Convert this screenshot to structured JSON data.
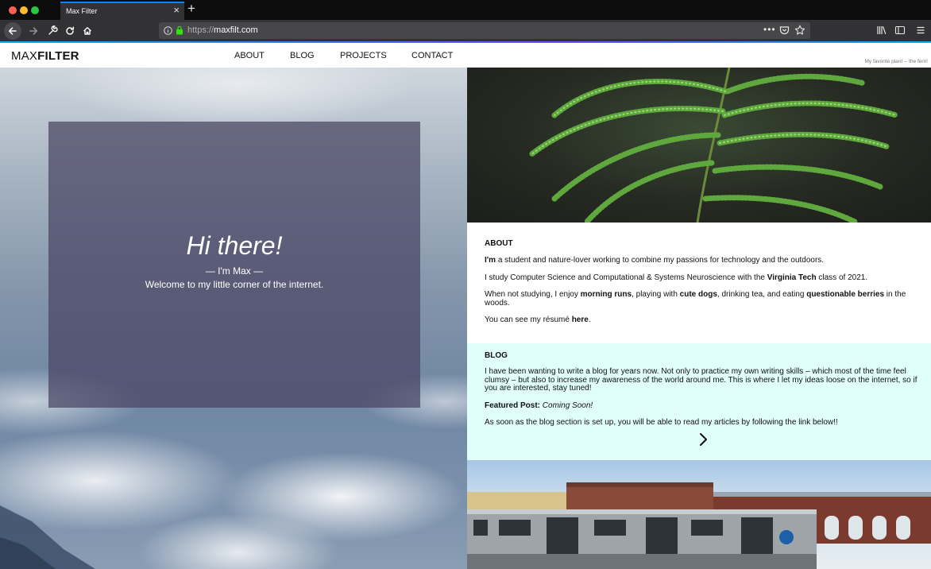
{
  "browser": {
    "tab_title": "Max Filter",
    "tab_close": "×",
    "new_tab": "+",
    "url_scheme": "https://",
    "url_host": "maxfilt.com",
    "url_more": "•••"
  },
  "nav": {
    "logo_light": "MAX",
    "logo_bold": "FILTER",
    "links": [
      "ABOUT",
      "BLOG",
      "PROJECTS",
      "CONTACT"
    ],
    "caption": "My favorite plant -- the fern!"
  },
  "hero": {
    "title": "Hi there!",
    "subtitle": "— I'm Max —",
    "welcome": "Welcome to my little corner of the internet."
  },
  "about": {
    "title": "ABOUT",
    "p1_bold": "I'm",
    "p1_rest": " a student and nature-lover working to combine my passions for technology and the outdoors.",
    "p2_start": "I study Computer Science and Computational & Systems Neuroscience with the ",
    "p2_bold": "Virginia Tech",
    "p2_end": " class of 2021.",
    "p3_a": "When not studying, I enjoy ",
    "p3_b": "morning runs",
    "p3_c": ", playing with ",
    "p3_d": "cute dogs",
    "p3_e": ", drinking tea, and eating ",
    "p3_f": "questionable berries",
    "p3_g": " in the woods.",
    "p4_start": "You can see my résumé ",
    "p4_link": "here",
    "p4_end": "."
  },
  "blog": {
    "title": "BLOG",
    "intro": "I have been wanting to write a blog for years now. Not only to practice my own writing skills – which most of the time feel clumsy – but also to increase my awareness of the world around me. This is where I let my ideas loose on the internet, so if you are interested, stay tuned!",
    "featured_label": "Featured Post:",
    "featured_value": "Coming Soon!",
    "outro": "As soon as the blog section is set up, you will be able to read my articles by following the link below!!"
  },
  "colors": {
    "blog_bg": "#e0fefb",
    "overlay": "#484462",
    "chrome_dark": "#0c0c0d",
    "chrome_toolbar": "#323234",
    "accent": "#0a84ff"
  },
  "icons": {
    "back": "arrow-left-icon",
    "forward": "arrow-right-icon",
    "tools": "wrench-icon",
    "reload": "reload-icon",
    "home": "home-icon",
    "info": "info-icon",
    "lock": "lock-icon",
    "pocket": "pocket-icon",
    "bookmark": "star-icon",
    "library": "library-icon",
    "sidebar": "sidebar-icon",
    "menu": "hamburger-menu-icon",
    "blog_link": "chevron-right-icon"
  }
}
